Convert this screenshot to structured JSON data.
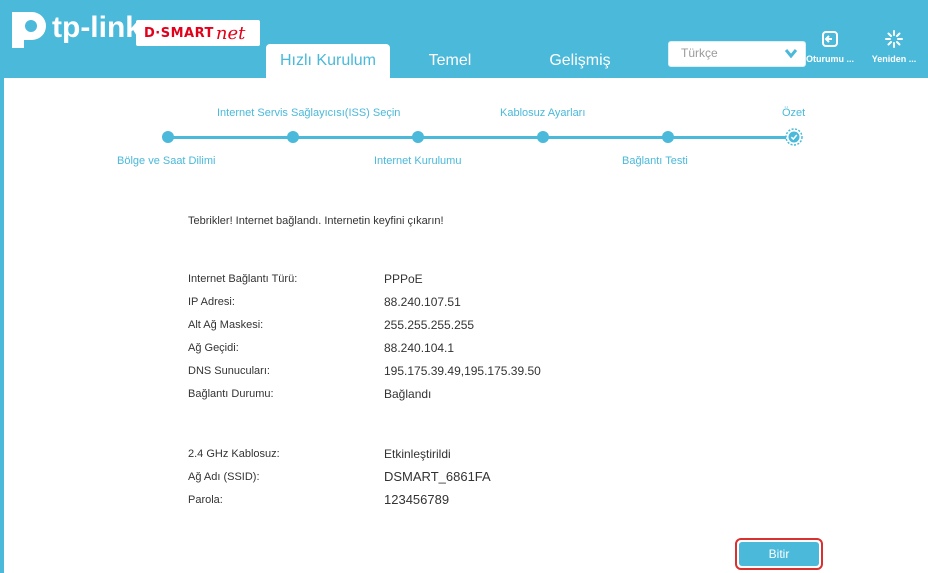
{
  "header": {
    "logo_text": "tp-link",
    "partner_logo": "D·SMART",
    "partner_logo_suffix": "net",
    "tabs": [
      "Hızlı Kurulum",
      "Temel",
      "Gelişmiş"
    ],
    "language": "Türkçe",
    "logout_label": "Oturumu ...",
    "reboot_label": "Yeniden ...",
    "accent_color": "#4ab9da"
  },
  "steps": {
    "top_labels": [
      "Internet Servis Sağlayıcısı(ISS) Seçin",
      "Kablosuz Ayarları",
      "Özet"
    ],
    "bottom_labels": [
      "Bölge ve Saat Dilimi",
      "Internet Kurulumu",
      "Bağlantı Testi"
    ]
  },
  "summary": {
    "message": "Tebrikler! Internet bağlandı. Internetin keyfini çıkarın!",
    "connection": [
      {
        "label": "Internet Bağlantı Türü:",
        "value": "PPPoE"
      },
      {
        "label": "IP Adresi:",
        "value": "88.240.107.51"
      },
      {
        "label": "Alt Ağ Maskesi:",
        "value": "255.255.255.255"
      },
      {
        "label": "Ağ Geçidi:",
        "value": "88.240.104.1"
      },
      {
        "label": "DNS Sunucuları:",
        "value": "195.175.39.49,195.175.39.50"
      },
      {
        "label": "Bağlantı Durumu:",
        "value": "Bağlandı"
      }
    ],
    "wireless": [
      {
        "label": "2.4 GHz Kablosuz:",
        "value": "Etkinleştirildi"
      },
      {
        "label": "Ağ Adı (SSID):",
        "value": "DSMART_6861FA"
      },
      {
        "label": "Parola:",
        "value": "123456789"
      }
    ]
  },
  "finish_label": "Bitir"
}
